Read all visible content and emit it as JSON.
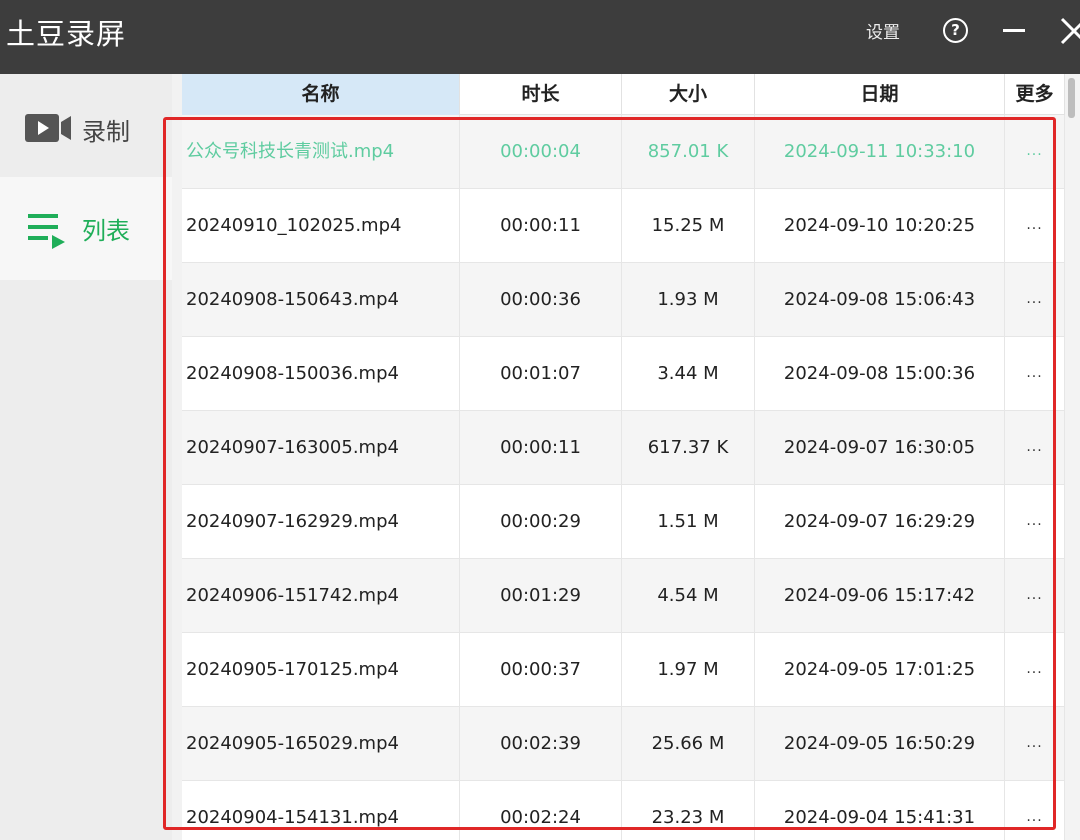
{
  "window": {
    "title": "土豆录屏",
    "settings_label": "设置",
    "help_label": "?"
  },
  "sidebar": {
    "items": [
      {
        "label": "录制",
        "icon": "video-camera-icon",
        "active": false
      },
      {
        "label": "列表",
        "icon": "list-play-icon",
        "active": true
      }
    ]
  },
  "table": {
    "columns": [
      "名称",
      "时长",
      "大小",
      "日期",
      "更多"
    ],
    "rows": [
      {
        "name": "公众号科技长青测试.mp4",
        "duration": "00:00:04",
        "size": "857.01 K",
        "date": "2024-09-11 10:33:10",
        "more": "..."
      },
      {
        "name": "20240910_102025.mp4",
        "duration": "00:00:11",
        "size": "15.25 M",
        "date": "2024-09-10 10:20:25",
        "more": "..."
      },
      {
        "name": "20240908-150643.mp4",
        "duration": "00:00:36",
        "size": "1.93 M",
        "date": "2024-09-08 15:06:43",
        "more": "..."
      },
      {
        "name": "20240908-150036.mp4",
        "duration": "00:01:07",
        "size": "3.44 M",
        "date": "2024-09-08 15:00:36",
        "more": "..."
      },
      {
        "name": "20240907-163005.mp4",
        "duration": "00:00:11",
        "size": "617.37 K",
        "date": "2024-09-07 16:30:05",
        "more": "..."
      },
      {
        "name": "20240907-162929.mp4",
        "duration": "00:00:29",
        "size": "1.51 M",
        "date": "2024-09-07 16:29:29",
        "more": "..."
      },
      {
        "name": "20240906-151742.mp4",
        "duration": "00:01:29",
        "size": "4.54 M",
        "date": "2024-09-06 15:17:42",
        "more": "..."
      },
      {
        "name": "20240905-170125.mp4",
        "duration": "00:00:37",
        "size": "1.97 M",
        "date": "2024-09-05 17:01:25",
        "more": "..."
      },
      {
        "name": "20240905-165029.mp4",
        "duration": "00:02:39",
        "size": "25.66 M",
        "date": "2024-09-05 16:50:29",
        "more": "..."
      },
      {
        "name": "20240904-154131.mp4",
        "duration": "00:02:24",
        "size": "23.23 M",
        "date": "2024-09-04 15:41:31",
        "more": "..."
      }
    ]
  },
  "colors": {
    "titlebar_bg": "#3d3d3d",
    "accent_green": "#1fae59",
    "active_row_text": "#5fcca0",
    "header_name_bg": "#d6e8f7",
    "highlight_border": "#e02727"
  }
}
